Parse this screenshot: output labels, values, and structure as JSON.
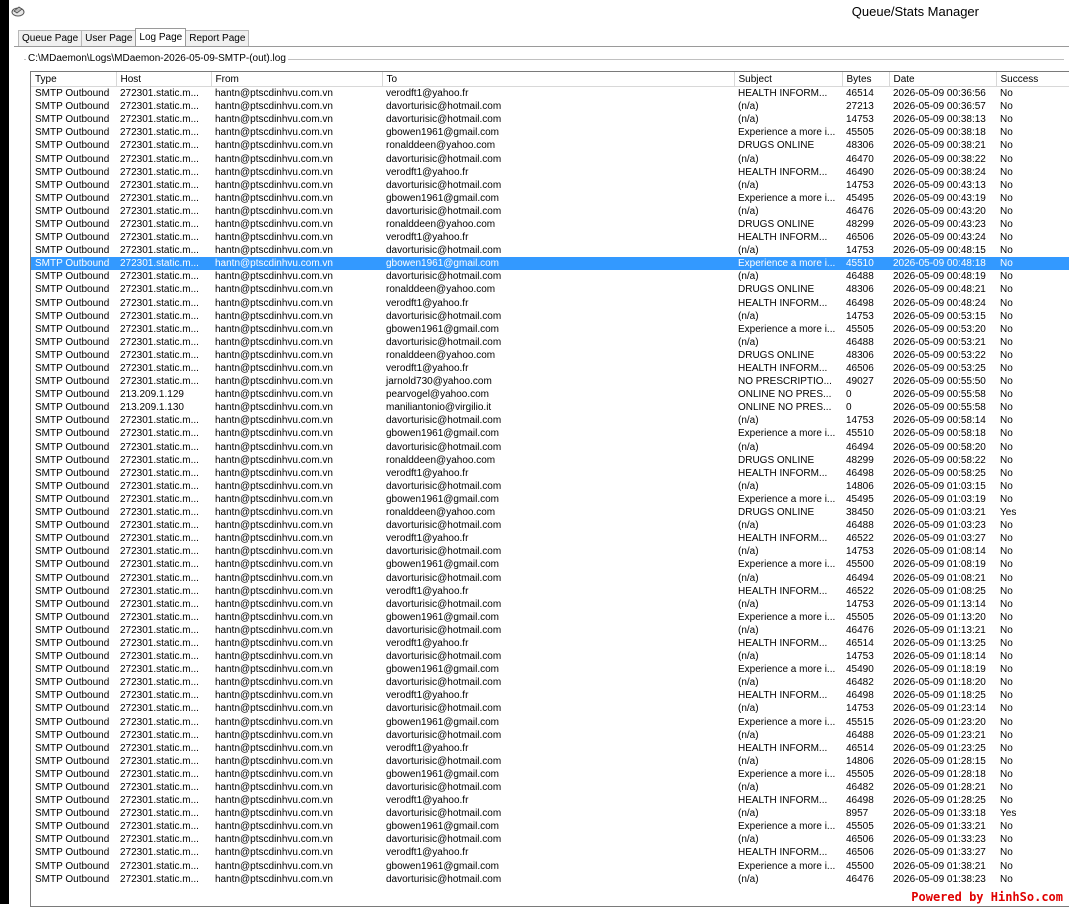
{
  "window": {
    "title": "Queue/Stats Manager"
  },
  "tabs": [
    "Queue Page",
    "User Page",
    "Log Page",
    "Report Page"
  ],
  "active_tab": 2,
  "log_path": "C:\\MDaemon\\Logs\\MDaemon-2026-05-09-SMTP-(out).log",
  "columns": [
    "Type",
    "Host",
    "From",
    "To",
    "Subject",
    "Bytes",
    "Date",
    "Success"
  ],
  "selected_row": 13,
  "rows": [
    [
      "SMTP Outbound",
      "272301.static.m...",
      "hantn@ptscdinhvu.com.vn",
      "verodft1@yahoo.fr",
      "HEALTH INFORM...",
      "46514",
      "2026-05-09 00:36:56",
      "No"
    ],
    [
      "SMTP Outbound",
      "272301.static.m...",
      "hantn@ptscdinhvu.com.vn",
      "davorturisic@hotmail.com",
      "(n/a)",
      "27213",
      "2026-05-09 00:36:57",
      "No"
    ],
    [
      "SMTP Outbound",
      "272301.static.m...",
      "hantn@ptscdinhvu.com.vn",
      "davorturisic@hotmail.com",
      "(n/a)",
      "14753",
      "2026-05-09 00:38:13",
      "No"
    ],
    [
      "SMTP Outbound",
      "272301.static.m...",
      "hantn@ptscdinhvu.com.vn",
      "gbowen1961@gmail.com",
      "Experience a more i...",
      "45505",
      "2026-05-09 00:38:18",
      "No"
    ],
    [
      "SMTP Outbound",
      "272301.static.m...",
      "hantn@ptscdinhvu.com.vn",
      "ronalddeen@yahoo.com",
      "DRUGS ONLINE",
      "48306",
      "2026-05-09 00:38:21",
      "No"
    ],
    [
      "SMTP Outbound",
      "272301.static.m...",
      "hantn@ptscdinhvu.com.vn",
      "davorturisic@hotmail.com",
      "(n/a)",
      "46470",
      "2026-05-09 00:38:22",
      "No"
    ],
    [
      "SMTP Outbound",
      "272301.static.m...",
      "hantn@ptscdinhvu.com.vn",
      "verodft1@yahoo.fr",
      "HEALTH INFORM...",
      "46490",
      "2026-05-09 00:38:24",
      "No"
    ],
    [
      "SMTP Outbound",
      "272301.static.m...",
      "hantn@ptscdinhvu.com.vn",
      "davorturisic@hotmail.com",
      "(n/a)",
      "14753",
      "2026-05-09 00:43:13",
      "No"
    ],
    [
      "SMTP Outbound",
      "272301.static.m...",
      "hantn@ptscdinhvu.com.vn",
      "gbowen1961@gmail.com",
      "Experience a more i...",
      "45495",
      "2026-05-09 00:43:19",
      "No"
    ],
    [
      "SMTP Outbound",
      "272301.static.m...",
      "hantn@ptscdinhvu.com.vn",
      "davorturisic@hotmail.com",
      "(n/a)",
      "46476",
      "2026-05-09 00:43:20",
      "No"
    ],
    [
      "SMTP Outbound",
      "272301.static.m...",
      "hantn@ptscdinhvu.com.vn",
      "ronalddeen@yahoo.com",
      "DRUGS ONLINE",
      "48299",
      "2026-05-09 00:43:23",
      "No"
    ],
    [
      "SMTP Outbound",
      "272301.static.m...",
      "hantn@ptscdinhvu.com.vn",
      "verodft1@yahoo.fr",
      "HEALTH INFORM...",
      "46506",
      "2026-05-09 00:43:24",
      "No"
    ],
    [
      "SMTP Outbound",
      "272301.static.m...",
      "hantn@ptscdinhvu.com.vn",
      "davorturisic@hotmail.com",
      "(n/a)",
      "14753",
      "2026-05-09 00:48:15",
      "No"
    ],
    [
      "SMTP Outbound",
      "272301.static.m...",
      "hantn@ptscdinhvu.com.vn",
      "gbowen1961@gmail.com",
      "Experience a more i...",
      "45510",
      "2026-05-09 00:48:18",
      "No"
    ],
    [
      "SMTP Outbound",
      "272301.static.m...",
      "hantn@ptscdinhvu.com.vn",
      "davorturisic@hotmail.com",
      "(n/a)",
      "46488",
      "2026-05-09 00:48:19",
      "No"
    ],
    [
      "SMTP Outbound",
      "272301.static.m...",
      "hantn@ptscdinhvu.com.vn",
      "ronalddeen@yahoo.com",
      "DRUGS ONLINE",
      "48306",
      "2026-05-09 00:48:21",
      "No"
    ],
    [
      "SMTP Outbound",
      "272301.static.m...",
      "hantn@ptscdinhvu.com.vn",
      "verodft1@yahoo.fr",
      "HEALTH INFORM...",
      "46498",
      "2026-05-09 00:48:24",
      "No"
    ],
    [
      "SMTP Outbound",
      "272301.static.m...",
      "hantn@ptscdinhvu.com.vn",
      "davorturisic@hotmail.com",
      "(n/a)",
      "14753",
      "2026-05-09 00:53:15",
      "No"
    ],
    [
      "SMTP Outbound",
      "272301.static.m...",
      "hantn@ptscdinhvu.com.vn",
      "gbowen1961@gmail.com",
      "Experience a more i...",
      "45505",
      "2026-05-09 00:53:20",
      "No"
    ],
    [
      "SMTP Outbound",
      "272301.static.m...",
      "hantn@ptscdinhvu.com.vn",
      "davorturisic@hotmail.com",
      "(n/a)",
      "46488",
      "2026-05-09 00:53:21",
      "No"
    ],
    [
      "SMTP Outbound",
      "272301.static.m...",
      "hantn@ptscdinhvu.com.vn",
      "ronalddeen@yahoo.com",
      "DRUGS ONLINE",
      "48306",
      "2026-05-09 00:53:22",
      "No"
    ],
    [
      "SMTP Outbound",
      "272301.static.m...",
      "hantn@ptscdinhvu.com.vn",
      "verodft1@yahoo.fr",
      "HEALTH INFORM...",
      "46506",
      "2026-05-09 00:53:25",
      "No"
    ],
    [
      "SMTP Outbound",
      "272301.static.m...",
      "hantn@ptscdinhvu.com.vn",
      "jarnold730@yahoo.com",
      "NO PRESCRIPTIO...",
      "49027",
      "2026-05-09 00:55:50",
      "No"
    ],
    [
      "SMTP Outbound",
      "213.209.1.129",
      "hantn@ptscdinhvu.com.vn",
      "pearvogel@yahoo.com",
      "ONLINE NO PRES...",
      "0",
      "2026-05-09 00:55:58",
      "No"
    ],
    [
      "SMTP Outbound",
      "213.209.1.130",
      "hantn@ptscdinhvu.com.vn",
      "maniliantonio@virgilio.it",
      "ONLINE NO PRES...",
      "0",
      "2026-05-09 00:55:58",
      "No"
    ],
    [
      "SMTP Outbound",
      "272301.static.m...",
      "hantn@ptscdinhvu.com.vn",
      "davorturisic@hotmail.com",
      "(n/a)",
      "14753",
      "2026-05-09 00:58:14",
      "No"
    ],
    [
      "SMTP Outbound",
      "272301.static.m...",
      "hantn@ptscdinhvu.com.vn",
      "gbowen1961@gmail.com",
      "Experience a more i...",
      "45510",
      "2026-05-09 00:58:18",
      "No"
    ],
    [
      "SMTP Outbound",
      "272301.static.m...",
      "hantn@ptscdinhvu.com.vn",
      "davorturisic@hotmail.com",
      "(n/a)",
      "46494",
      "2026-05-09 00:58:20",
      "No"
    ],
    [
      "SMTP Outbound",
      "272301.static.m...",
      "hantn@ptscdinhvu.com.vn",
      "ronalddeen@yahoo.com",
      "DRUGS ONLINE",
      "48299",
      "2026-05-09 00:58:22",
      "No"
    ],
    [
      "SMTP Outbound",
      "272301.static.m...",
      "hantn@ptscdinhvu.com.vn",
      "verodft1@yahoo.fr",
      "HEALTH INFORM...",
      "46498",
      "2026-05-09 00:58:25",
      "No"
    ],
    [
      "SMTP Outbound",
      "272301.static.m...",
      "hantn@ptscdinhvu.com.vn",
      "davorturisic@hotmail.com",
      "(n/a)",
      "14806",
      "2026-05-09 01:03:15",
      "No"
    ],
    [
      "SMTP Outbound",
      "272301.static.m...",
      "hantn@ptscdinhvu.com.vn",
      "gbowen1961@gmail.com",
      "Experience a more i...",
      "45495",
      "2026-05-09 01:03:19",
      "No"
    ],
    [
      "SMTP Outbound",
      "272301.static.m...",
      "hantn@ptscdinhvu.com.vn",
      "ronalddeen@yahoo.com",
      "DRUGS ONLINE",
      "38450",
      "2026-05-09 01:03:21",
      "Yes"
    ],
    [
      "SMTP Outbound",
      "272301.static.m...",
      "hantn@ptscdinhvu.com.vn",
      "davorturisic@hotmail.com",
      "(n/a)",
      "46488",
      "2026-05-09 01:03:23",
      "No"
    ],
    [
      "SMTP Outbound",
      "272301.static.m...",
      "hantn@ptscdinhvu.com.vn",
      "verodft1@yahoo.fr",
      "HEALTH INFORM...",
      "46522",
      "2026-05-09 01:03:27",
      "No"
    ],
    [
      "SMTP Outbound",
      "272301.static.m...",
      "hantn@ptscdinhvu.com.vn",
      "davorturisic@hotmail.com",
      "(n/a)",
      "14753",
      "2026-05-09 01:08:14",
      "No"
    ],
    [
      "SMTP Outbound",
      "272301.static.m...",
      "hantn@ptscdinhvu.com.vn",
      "gbowen1961@gmail.com",
      "Experience a more i...",
      "45500",
      "2026-05-09 01:08:19",
      "No"
    ],
    [
      "SMTP Outbound",
      "272301.static.m...",
      "hantn@ptscdinhvu.com.vn",
      "davorturisic@hotmail.com",
      "(n/a)",
      "46494",
      "2026-05-09 01:08:21",
      "No"
    ],
    [
      "SMTP Outbound",
      "272301.static.m...",
      "hantn@ptscdinhvu.com.vn",
      "verodft1@yahoo.fr",
      "HEALTH INFORM...",
      "46522",
      "2026-05-09 01:08:25",
      "No"
    ],
    [
      "SMTP Outbound",
      "272301.static.m...",
      "hantn@ptscdinhvu.com.vn",
      "davorturisic@hotmail.com",
      "(n/a)",
      "14753",
      "2026-05-09 01:13:14",
      "No"
    ],
    [
      "SMTP Outbound",
      "272301.static.m...",
      "hantn@ptscdinhvu.com.vn",
      "gbowen1961@gmail.com",
      "Experience a more i...",
      "45505",
      "2026-05-09 01:13:20",
      "No"
    ],
    [
      "SMTP Outbound",
      "272301.static.m...",
      "hantn@ptscdinhvu.com.vn",
      "davorturisic@hotmail.com",
      "(n/a)",
      "46476",
      "2026-05-09 01:13:21",
      "No"
    ],
    [
      "SMTP Outbound",
      "272301.static.m...",
      "hantn@ptscdinhvu.com.vn",
      "verodft1@yahoo.fr",
      "HEALTH INFORM...",
      "46514",
      "2026-05-09 01:13:25",
      "No"
    ],
    [
      "SMTP Outbound",
      "272301.static.m...",
      "hantn@ptscdinhvu.com.vn",
      "davorturisic@hotmail.com",
      "(n/a)",
      "14753",
      "2026-05-09 01:18:14",
      "No"
    ],
    [
      "SMTP Outbound",
      "272301.static.m...",
      "hantn@ptscdinhvu.com.vn",
      "gbowen1961@gmail.com",
      "Experience a more i...",
      "45490",
      "2026-05-09 01:18:19",
      "No"
    ],
    [
      "SMTP Outbound",
      "272301.static.m...",
      "hantn@ptscdinhvu.com.vn",
      "davorturisic@hotmail.com",
      "(n/a)",
      "46482",
      "2026-05-09 01:18:20",
      "No"
    ],
    [
      "SMTP Outbound",
      "272301.static.m...",
      "hantn@ptscdinhvu.com.vn",
      "verodft1@yahoo.fr",
      "HEALTH INFORM...",
      "46498",
      "2026-05-09 01:18:25",
      "No"
    ],
    [
      "SMTP Outbound",
      "272301.static.m...",
      "hantn@ptscdinhvu.com.vn",
      "davorturisic@hotmail.com",
      "(n/a)",
      "14753",
      "2026-05-09 01:23:14",
      "No"
    ],
    [
      "SMTP Outbound",
      "272301.static.m...",
      "hantn@ptscdinhvu.com.vn",
      "gbowen1961@gmail.com",
      "Experience a more i...",
      "45515",
      "2026-05-09 01:23:20",
      "No"
    ],
    [
      "SMTP Outbound",
      "272301.static.m...",
      "hantn@ptscdinhvu.com.vn",
      "davorturisic@hotmail.com",
      "(n/a)",
      "46488",
      "2026-05-09 01:23:21",
      "No"
    ],
    [
      "SMTP Outbound",
      "272301.static.m...",
      "hantn@ptscdinhvu.com.vn",
      "verodft1@yahoo.fr",
      "HEALTH INFORM...",
      "46514",
      "2026-05-09 01:23:25",
      "No"
    ],
    [
      "SMTP Outbound",
      "272301.static.m...",
      "hantn@ptscdinhvu.com.vn",
      "davorturisic@hotmail.com",
      "(n/a)",
      "14806",
      "2026-05-09 01:28:15",
      "No"
    ],
    [
      "SMTP Outbound",
      "272301.static.m...",
      "hantn@ptscdinhvu.com.vn",
      "gbowen1961@gmail.com",
      "Experience a more i...",
      "45505",
      "2026-05-09 01:28:18",
      "No"
    ],
    [
      "SMTP Outbound",
      "272301.static.m...",
      "hantn@ptscdinhvu.com.vn",
      "davorturisic@hotmail.com",
      "(n/a)",
      "46482",
      "2026-05-09 01:28:21",
      "No"
    ],
    [
      "SMTP Outbound",
      "272301.static.m...",
      "hantn@ptscdinhvu.com.vn",
      "verodft1@yahoo.fr",
      "HEALTH INFORM...",
      "46498",
      "2026-05-09 01:28:25",
      "No"
    ],
    [
      "SMTP Outbound",
      "272301.static.m...",
      "hantn@ptscdinhvu.com.vn",
      "davorturisic@hotmail.com",
      "(n/a)",
      "8957",
      "2026-05-09 01:33:18",
      "Yes"
    ],
    [
      "SMTP Outbound",
      "272301.static.m...",
      "hantn@ptscdinhvu.com.vn",
      "gbowen1961@gmail.com",
      "Experience a more i...",
      "45505",
      "2026-05-09 01:33:21",
      "No"
    ],
    [
      "SMTP Outbound",
      "272301.static.m...",
      "hantn@ptscdinhvu.com.vn",
      "davorturisic@hotmail.com",
      "(n/a)",
      "46506",
      "2026-05-09 01:33:23",
      "No"
    ],
    [
      "SMTP Outbound",
      "272301.static.m...",
      "hantn@ptscdinhvu.com.vn",
      "verodft1@yahoo.fr",
      "HEALTH INFORM...",
      "46506",
      "2026-05-09 01:33:27",
      "No"
    ],
    [
      "SMTP Outbound",
      "272301.static.m...",
      "hantn@ptscdinhvu.com.vn",
      "gbowen1961@gmail.com",
      "Experience a more i...",
      "45500",
      "2026-05-09 01:38:21",
      "No"
    ],
    [
      "SMTP Outbound",
      "272301.static.m...",
      "hantn@ptscdinhvu.com.vn",
      "davorturisic@hotmail.com",
      "(n/a)",
      "46476",
      "2026-05-09 01:38:23",
      "No"
    ]
  ],
  "watermark": "Powered by HinhSo.com",
  "colors": {
    "selection": "#3399ff",
    "watermark": "#e00000"
  }
}
